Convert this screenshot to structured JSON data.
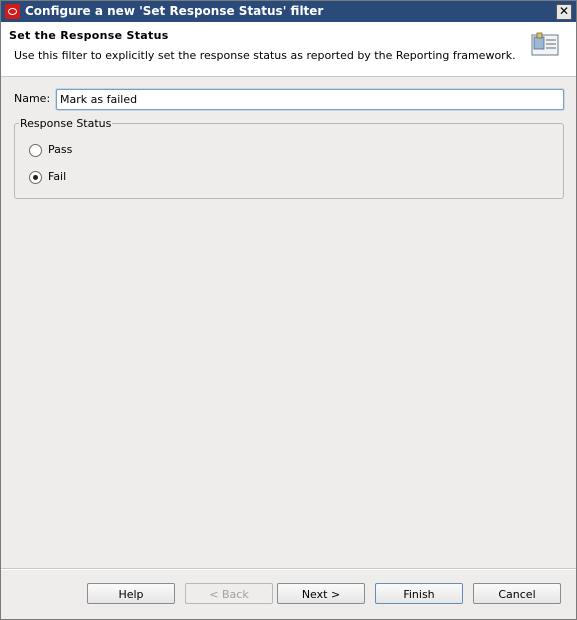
{
  "window": {
    "title": "Configure a new 'Set Response Status' filter",
    "close_symbol": "✕"
  },
  "header": {
    "title": "Set the Response Status",
    "description": "Use this filter to explicitly set the response status as reported by the Reporting framework.",
    "icon": "clipboard-filter-icon"
  },
  "form": {
    "name_label": "Name:",
    "name_value": "Mark as failed",
    "group_label": "Response Status",
    "options": [
      {
        "label": "Pass",
        "checked": false
      },
      {
        "label": "Fail",
        "checked": true
      }
    ]
  },
  "buttons": {
    "help": "Help",
    "back": "< Back",
    "next": "Next >",
    "finish": "Finish",
    "cancel": "Cancel"
  }
}
